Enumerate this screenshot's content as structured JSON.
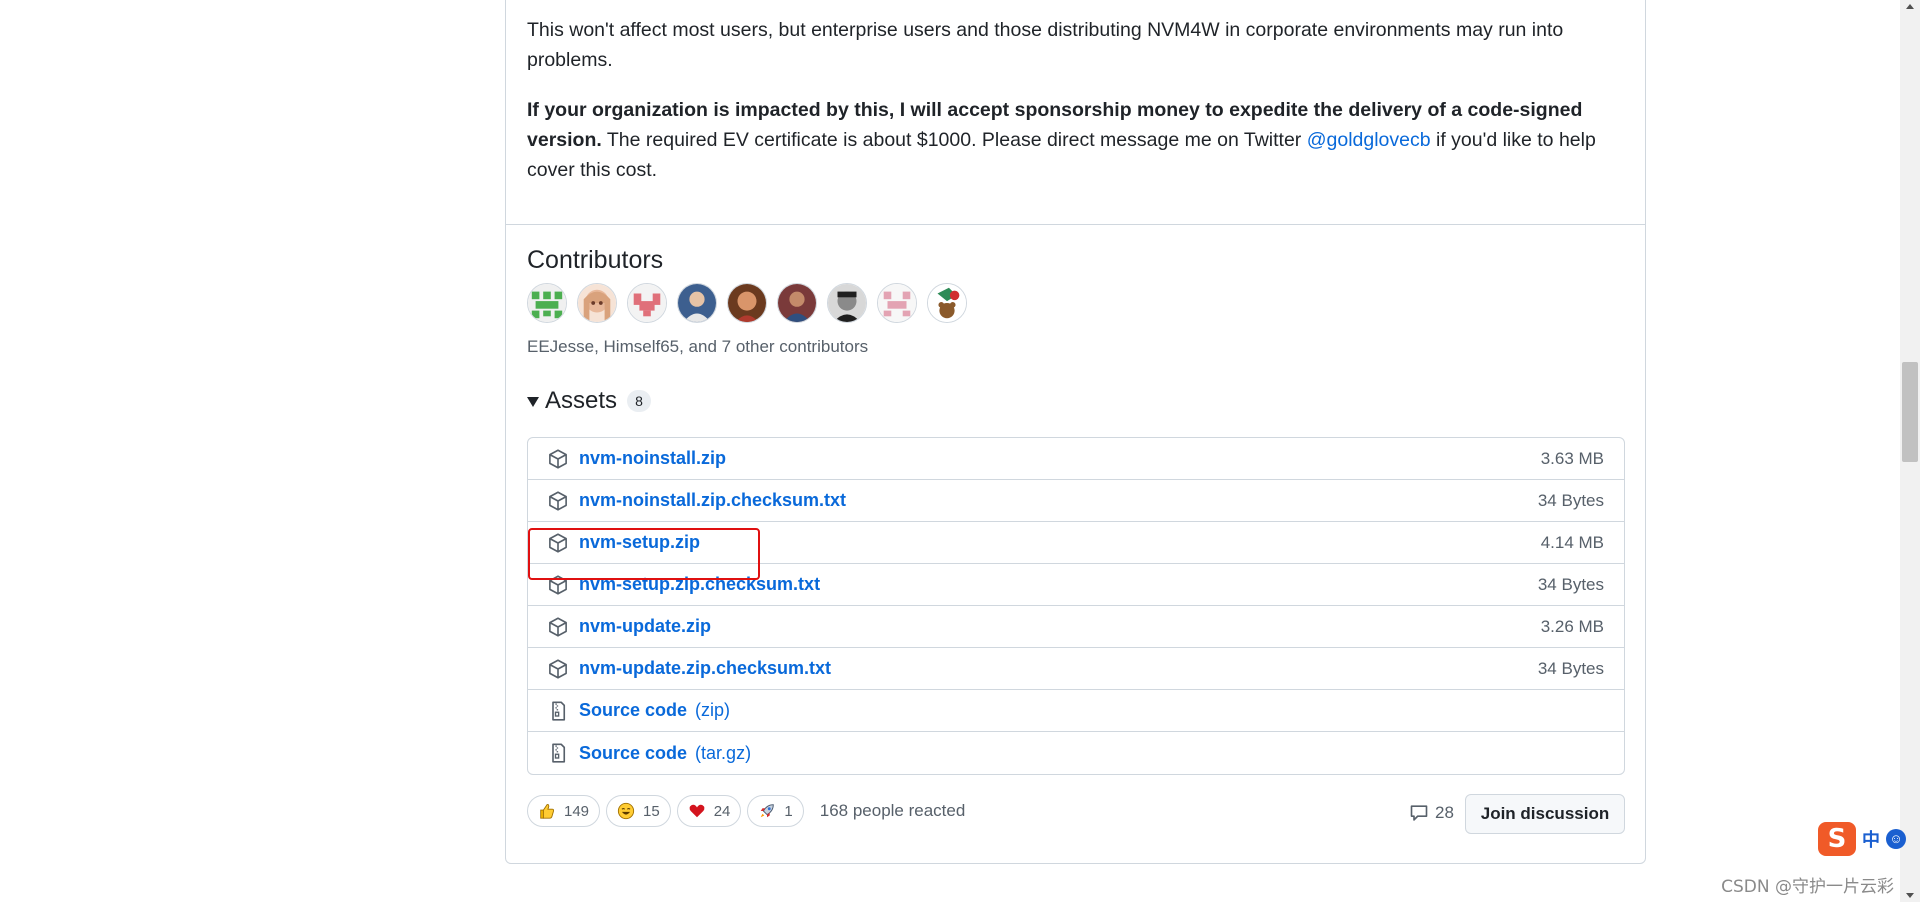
{
  "release": {
    "paragraph1": "This won't affect most users, but enterprise users and those distributing NVM4W in corporate environments may run into problems.",
    "paragraph2_bold": "If your organization is impacted by this, I will accept sponsorship money to expedite the delivery of a code-signed version.",
    "paragraph2_text": " The required EV certificate is about $1000. Please direct message me on Twitter ",
    "paragraph2_link": "@goldglovecb",
    "paragraph2_tail": " if you'd like to help cover this cost."
  },
  "contributors": {
    "title": "Contributors",
    "summary": "EEJesse, Himself65, and 7 other contributors",
    "avatars": [
      {
        "name": "avatar-1",
        "color": "#4caf50"
      },
      {
        "name": "avatar-2",
        "color": "#f0c8b8"
      },
      {
        "name": "avatar-3",
        "color": "#e0707a"
      },
      {
        "name": "avatar-4",
        "color": "#4a6fa5"
      },
      {
        "name": "avatar-5",
        "color": "#a0522d"
      },
      {
        "name": "avatar-6",
        "color": "#5a4a8a"
      },
      {
        "name": "avatar-7",
        "color": "#2b2b2b"
      },
      {
        "name": "avatar-8",
        "color": "#e0a0b0"
      },
      {
        "name": "avatar-9",
        "color": "#2e8b57"
      }
    ]
  },
  "assets": {
    "title": "Assets",
    "count": "8",
    "items": [
      {
        "name": "nvm-noinstall.zip",
        "size": "3.63 MB",
        "type": "package"
      },
      {
        "name": "nvm-noinstall.zip.checksum.txt",
        "size": "34 Bytes",
        "type": "package"
      },
      {
        "name": "nvm-setup.zip",
        "size": "4.14 MB",
        "type": "package"
      },
      {
        "name": "nvm-setup.zip.checksum.txt",
        "size": "34 Bytes",
        "type": "package"
      },
      {
        "name": "nvm-update.zip",
        "size": "3.26 MB",
        "type": "package"
      },
      {
        "name": "nvm-update.zip.checksum.txt",
        "size": "34 Bytes",
        "type": "package"
      },
      {
        "name": "Source code",
        "suffix": "(zip)",
        "size": "",
        "type": "file-zip"
      },
      {
        "name": "Source code",
        "suffix": "(tar.gz)",
        "size": "",
        "type": "file-zip"
      }
    ]
  },
  "reactions": {
    "items": [
      {
        "emoji": "thumbs-up",
        "count": "149"
      },
      {
        "emoji": "laugh",
        "count": "15"
      },
      {
        "emoji": "heart",
        "count": "24"
      },
      {
        "emoji": "rocket",
        "count": "1"
      }
    ],
    "summary": "168 people reacted"
  },
  "discussion": {
    "comment_count": "28",
    "join_label": "Join discussion"
  },
  "ime": {
    "logo": "S",
    "mode": "中"
  },
  "watermark": "CSDN @守护一片云彩"
}
